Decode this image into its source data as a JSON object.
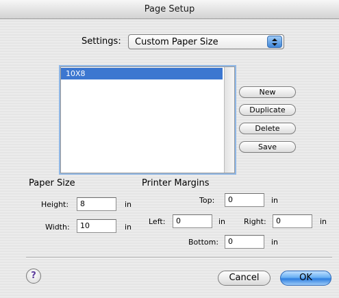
{
  "window": {
    "title": "Page Setup"
  },
  "settings": {
    "label": "Settings:",
    "selected": "Custom Paper Size"
  },
  "paper_list": {
    "items": [
      "10X8"
    ]
  },
  "list_buttons": {
    "new": "New",
    "duplicate": "Duplicate",
    "delete": "Delete",
    "save": "Save"
  },
  "paper_size": {
    "title": "Paper Size",
    "height_label": "Height:",
    "height_value": "8",
    "width_label": "Width:",
    "width_value": "10",
    "unit": "in"
  },
  "margins": {
    "title": "Printer Margins",
    "top_label": "Top:",
    "top_value": "0",
    "left_label": "Left:",
    "left_value": "0",
    "right_label": "Right:",
    "right_value": "0",
    "bottom_label": "Bottom:",
    "bottom_value": "0",
    "unit": "in"
  },
  "footer": {
    "help": "?",
    "cancel": "Cancel",
    "ok": "OK"
  },
  "colors": {
    "selection": "#3c77d0",
    "default_button": "#6ab0f3"
  },
  "icons": {
    "popup": "updown-arrows-icon",
    "help": "help-icon"
  }
}
